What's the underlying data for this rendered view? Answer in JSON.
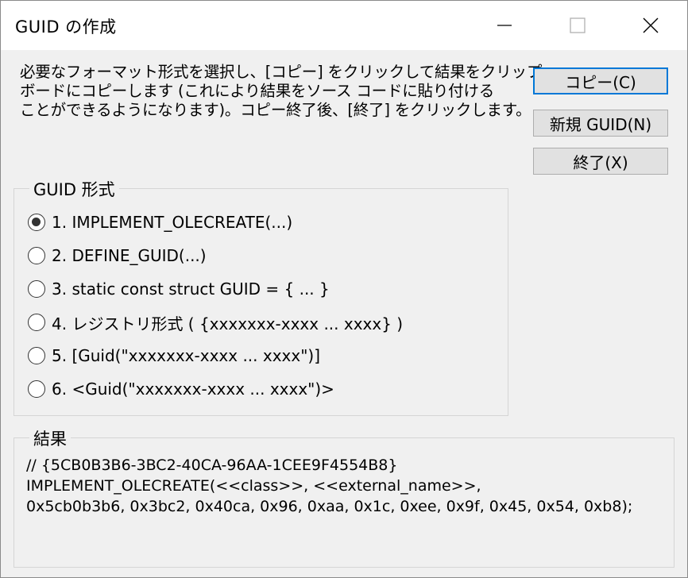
{
  "window": {
    "title": "GUID の作成",
    "minimize_icon": "minimize-icon",
    "maximize_icon": "maximize-icon",
    "close_icon": "close-icon"
  },
  "instructions": [
    "必要なフォーマット形式を選択し、[コピー] をクリックして結果をクリップ",
    "ボードにコピーします (これにより結果をソース コードに貼り付ける",
    "ことができるようになります)。コピー終了後、[終了] をクリックします。"
  ],
  "buttons": {
    "copy": "コピー(C)",
    "new_guid": "新規 GUID(N)",
    "exit": "終了(X)"
  },
  "format_group": {
    "legend": "GUID 形式",
    "selected_index": 0,
    "options": [
      "1. IMPLEMENT_OLECREATE(...)",
      "2. DEFINE_GUID(...)",
      "3. static const struct GUID = { ... }",
      "4. レジストリ形式 ( {xxxxxxx-xxxx ... xxxx} )",
      "5. [Guid(\"xxxxxxx-xxxx ... xxxx\")]",
      "6. <Guid(\"xxxxxxx-xxxx ... xxxx\")>"
    ]
  },
  "result_group": {
    "legend": "結果",
    "lines": [
      "// {5CB0B3B6-3BC2-40CA-96AA-1CEE9F4554B8}",
      "IMPLEMENT_OLECREATE(<<class>>, <<external_name>>,",
      "0x5cb0b3b6, 0x3bc2, 0x40ca, 0x96, 0xaa, 0x1c, 0xee, 0x9f, 0x45, 0x54, 0xb8);"
    ]
  }
}
